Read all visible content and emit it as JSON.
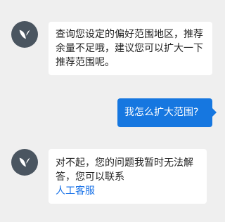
{
  "colors": {
    "background": "#efefef",
    "bot_bubble": "#ffffff",
    "user_bubble": "#1677e0",
    "link": "#1a73e8",
    "avatar": "#4a5560"
  },
  "messages": [
    {
      "sender": "bot",
      "avatar_icon": "leaf-logo-icon",
      "text": "查询您设定的偏好范围地区，推荐余量不足哦，建议您可以扩大一下推荐范围呢。"
    },
    {
      "sender": "user",
      "text": "我怎么扩大范围?"
    },
    {
      "sender": "bot",
      "avatar_icon": "leaf-logo-icon",
      "text": "对不起，您的问题我暂时无法解答，您可以联系",
      "link": "人工客服"
    }
  ]
}
